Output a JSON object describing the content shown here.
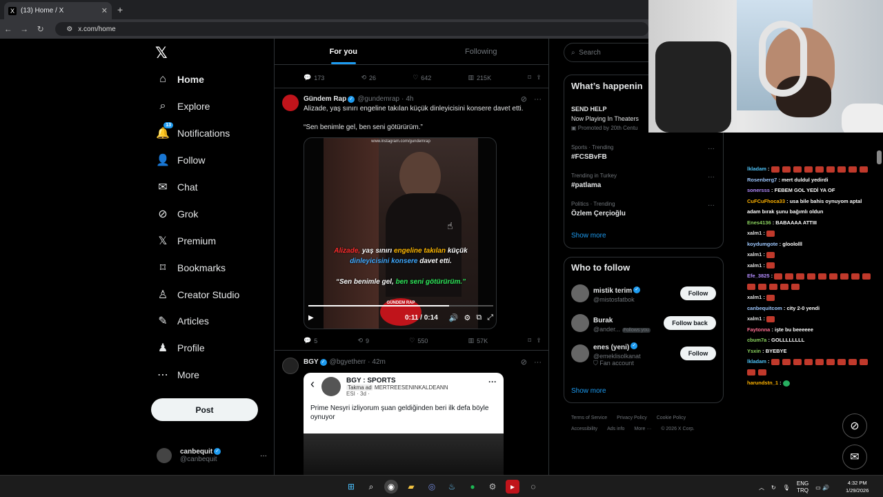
{
  "browser": {
    "tab_title": "(13) Home / X",
    "tab_favicon": "X",
    "url": "x.com/home"
  },
  "nav": {
    "logo": "𝕏",
    "items": [
      {
        "label": "Home",
        "icon": "⌂",
        "badge": ""
      },
      {
        "label": "Explore",
        "icon": "⌕",
        "badge": ""
      },
      {
        "label": "Notifications",
        "icon": "🔔",
        "badge": "13"
      },
      {
        "label": "Follow",
        "icon": "👤",
        "badge": ""
      },
      {
        "label": "Chat",
        "icon": "✉",
        "badge": ""
      },
      {
        "label": "Grok",
        "icon": "⊘",
        "badge": ""
      },
      {
        "label": "Premium",
        "icon": "𝕏",
        "badge": ""
      },
      {
        "label": "Bookmarks",
        "icon": "⌑",
        "badge": ""
      },
      {
        "label": "Creator Studio",
        "icon": "♙",
        "badge": ""
      },
      {
        "label": "Articles",
        "icon": "✎",
        "badge": ""
      },
      {
        "label": "Profile",
        "icon": "♟",
        "badge": ""
      },
      {
        "label": "More",
        "icon": "⋯",
        "badge": ""
      }
    ],
    "post_label": "Post",
    "account": {
      "name": "canbequit",
      "handle": "@canbequit",
      "more": "···"
    }
  },
  "timeline": {
    "tabs": {
      "for_you": "For you",
      "following": "Following"
    },
    "prev_actions": {
      "replies": "173",
      "reposts": "26",
      "likes": "642",
      "views": "215K"
    },
    "tweet1": {
      "name": "Gündem Rap",
      "handle": "@gundemrap",
      "time": "4h",
      "text": "Alizade, yaş sınırı engeline takılan küçük dinleyicisini konsere davet etti.",
      "quote": "“Sen benimle gel, ben seni götürürüm.”",
      "video": {
        "watermark": "www.instagram.com/gundemrap",
        "cap_w1": "Alizade,",
        "cap_w2": "yaş sınırı",
        "cap_w3": "engeline takılan",
        "cap_w4": "küçük",
        "cap_w5": "dinleyicisini konsere",
        "cap_w6": "davet etti.",
        "cap2_a": "“Sen benimle gel,",
        "cap2_b": "ben seni götürürüm.”",
        "logo_text": "GÜNDEM RAP",
        "time": "0:11 / 0:14",
        "progress": 0.76
      },
      "actions": {
        "replies": "5",
        "reposts": "9",
        "likes": "550",
        "views": "57K"
      }
    },
    "tweet2": {
      "name": "BGY",
      "handle": "@bgyetherr",
      "time": "42m",
      "card": {
        "title": "BGY : SPORTS",
        "tag": "Takma ad",
        "tag_extra": "MERTREESENINKALDEANN",
        "sub": "ESI · 3d ·",
        "text": "Prime Nesyri izliyorum şuan geldiğinden beri ilk defa böyle oynuyor"
      }
    }
  },
  "right": {
    "search_placeholder": "Search",
    "happening_title": "What’s happenin",
    "promo": {
      "title": "SEND HELP",
      "line": "Now Playing In Theaters",
      "promoted": "Promoted by 20th Centu"
    },
    "trends": [
      {
        "meta": "Sports · Trending",
        "name": "#FCSBvFB"
      },
      {
        "meta": "Trending in Turkey",
        "name": "#patlama"
      },
      {
        "meta": "Politics · Trending",
        "name": "Özlem Çerçioğlu"
      }
    ],
    "show_more": "Show more",
    "wtf_title": "Who to follow",
    "wtf": [
      {
        "name": "mistik terim",
        "handle": "@mistosfatbok",
        "btn": "Follow",
        "extra": ""
      },
      {
        "name": "Burak",
        "handle": "@ander...",
        "btn": "Follow back",
        "extra": "Follows you"
      },
      {
        "name": "enes (yeni)",
        "handle": "@emeklisolkanat",
        "btn": "Follow",
        "extra": "Fan account"
      }
    ],
    "wtf_show_more": "Show more",
    "footer": [
      "Terms of Service",
      "Privacy Policy",
      "Cookie Policy",
      "Accessibility",
      "Ads info",
      "More ···",
      "© 2026 X Corp."
    ]
  },
  "chat": [
    {
      "user": "lkladam",
      "color": "#4fc3f7",
      "msg": "",
      "emotes": 9
    },
    {
      "user": "Rosenberg7",
      "color": "#9ec8ff",
      "msg": "mert duldul yedirdi",
      "emotes": 0
    },
    {
      "user": "sonersss",
      "color": "#b48cff",
      "msg": "FEBEM GOL YEDİ YA OF",
      "emotes": 0
    },
    {
      "user": "CuFCuFhoca33",
      "color": "#ffb300",
      "msg": "usa bile bahis oynuyom aptal adam bırak şunu bağımlı oldun",
      "emotes": 0
    },
    {
      "user": "Enes4136",
      "color": "#8bd35f",
      "msg": "BABAAAA ATTIII",
      "emotes": 0
    },
    {
      "user": "xalm1",
      "color": "#e0e0e0",
      "msg": "",
      "emotes": 1
    },
    {
      "user": "koydumgote",
      "color": "#9ec8ff",
      "msg": "gloololll",
      "emotes": 0
    },
    {
      "user": "xalm1",
      "color": "#e0e0e0",
      "msg": "",
      "emotes": 1
    },
    {
      "user": "xalm1",
      "color": "#e0e0e0",
      "msg": "",
      "emotes": 1
    },
    {
      "user": "Efe_3825",
      "color": "#b48cff",
      "msg": "",
      "emotes": 14
    },
    {
      "user": "xalm1",
      "color": "#e0e0e0",
      "msg": "",
      "emotes": 1
    },
    {
      "user": "canbequitcom",
      "color": "#9ec8ff",
      "msg": "city 2-0 yendi",
      "emotes": 0
    },
    {
      "user": "xalm1",
      "color": "#e0e0e0",
      "msg": "",
      "emotes": 1
    },
    {
      "user": "Faytonna",
      "color": "#ff6f91",
      "msg": "işte bu beeeeee",
      "emotes": 0
    },
    {
      "user": "cbum7a",
      "color": "#8bd35f",
      "msg": "GOLLLLLLLL",
      "emotes": 0
    },
    {
      "user": "Ysxin",
      "color": "#8bd35f",
      "msg": "BYEBYE",
      "emotes": 0
    },
    {
      "user": "lkladam",
      "color": "#4fc3f7",
      "msg": "",
      "emotes": 11
    },
    {
      "user": "harundstn_1",
      "color": "#ffb300",
      "msg": "",
      "emotes": -1
    }
  ],
  "taskbar": {
    "lang_top": "ENG",
    "lang_bottom": "TRQ",
    "time": "4:32 PM",
    "date": "1/29/2026"
  }
}
